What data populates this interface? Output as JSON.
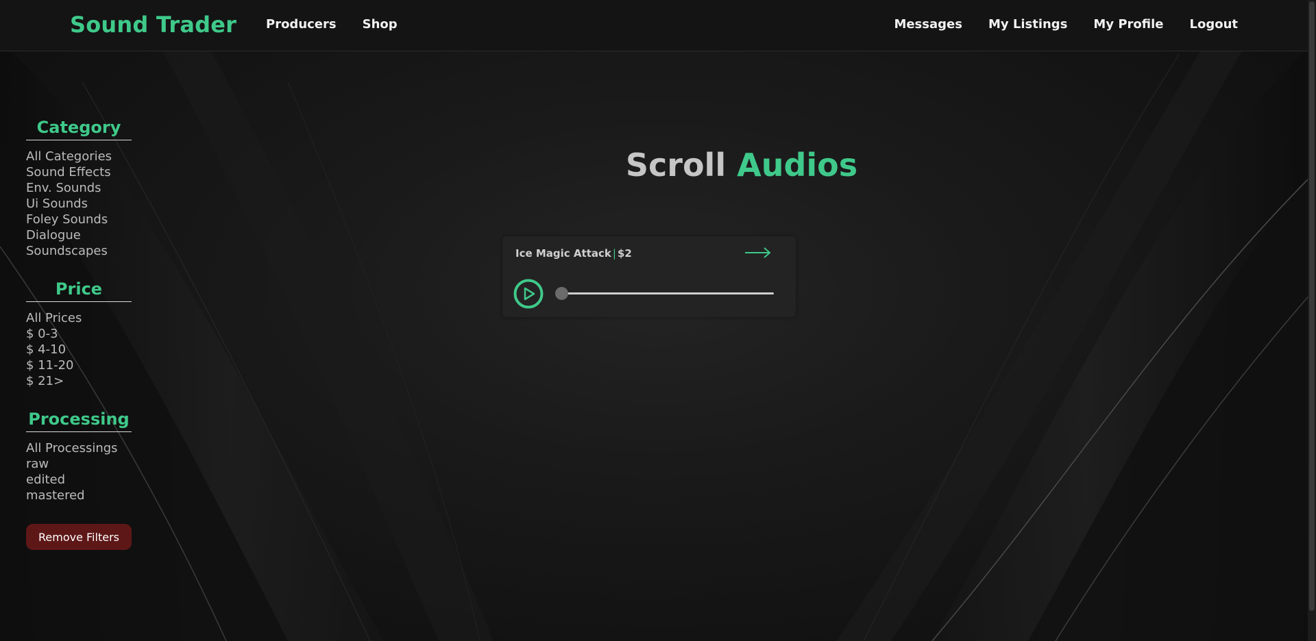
{
  "header": {
    "brand": "Sound Trader",
    "nav_left": [
      {
        "label": "Producers"
      },
      {
        "label": "Shop"
      }
    ],
    "nav_right": [
      {
        "label": "Messages"
      },
      {
        "label": "My Listings"
      },
      {
        "label": "My Profile"
      },
      {
        "label": "Logout"
      }
    ]
  },
  "sidebar": {
    "category": {
      "heading": "Category",
      "items": [
        "All Categories",
        "Sound Effects",
        "Env. Sounds",
        "Ui Sounds",
        "Foley Sounds",
        "Dialogue",
        "Soundscapes"
      ]
    },
    "price": {
      "heading": "Price",
      "items": [
        "All Prices",
        "$ 0-3",
        "$ 4-10",
        "$ 11-20",
        "$ 21>"
      ]
    },
    "processing": {
      "heading": "Processing",
      "items": [
        "All Processings",
        "raw",
        "edited",
        "mastered"
      ]
    },
    "remove_filters_label": "Remove Filters"
  },
  "main": {
    "title_part1": "Scroll",
    "title_part2": "Audios",
    "audio_card": {
      "name": "Ice Magic Attack",
      "separator": "|",
      "price": "$2",
      "progress": 0,
      "icons": {
        "play": "play-icon",
        "open": "arrow-right-icon"
      }
    }
  },
  "colors": {
    "accent": "#3fc98a",
    "danger": "#5e1717",
    "background": "#141414"
  }
}
